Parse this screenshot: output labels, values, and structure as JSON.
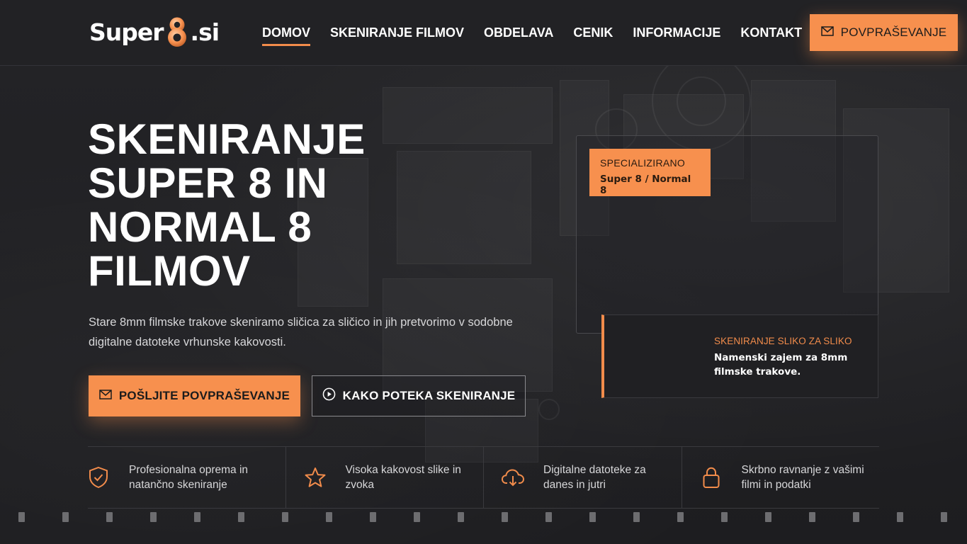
{
  "header": {
    "logo_left": "Super",
    "logo_right": ".si",
    "nav": [
      {
        "label": "DOMOV",
        "active": true
      },
      {
        "label": "SKENIRANJE FILMOV",
        "active": false
      },
      {
        "label": "OBDELAVA",
        "active": false
      },
      {
        "label": "CENIK",
        "active": false
      },
      {
        "label": "INFORMACIJE",
        "active": false
      },
      {
        "label": "KONTAKT",
        "active": false
      }
    ],
    "cta_label": "POVPRAŠEVANJE",
    "cta_icon": "envelope-icon"
  },
  "hero": {
    "title": "SKENIRANJE SUPER 8 IN NORMAL 8 FILMOV",
    "description": "Stare 8mm filmske trakove skeniramo sličica za sličico in jih pretvorimo v sodobne digitalne datoteke vrhunske kakovosti.",
    "primary_button": "POŠLJITE POVPRAŠEVANJE",
    "secondary_button": "KAKO POTEKA SKENIRANJE"
  },
  "panel": {
    "badge_top": "SPECIALIZIRANO",
    "badge_bottom": "Super 8 / Normal 8",
    "card_label": "SKENIRANJE SLIKO ZA SLIKO",
    "card_text": "Namenski zajem za 8mm filmske trakove."
  },
  "features": [
    {
      "icon": "shield-check-icon",
      "text": "Profesionalna oprema in natančno skeniranje"
    },
    {
      "icon": "star-icon",
      "text": "Visoka kakovost slike in zvoka"
    },
    {
      "icon": "cloud-download-icon",
      "text": "Digitalne datoteke za danes in jutri"
    },
    {
      "icon": "lock-icon",
      "text": "Skrbno ravnanje z vašimi filmi in podatki"
    }
  ],
  "colors": {
    "accent": "#f7904e",
    "background": "#1f1f21",
    "header": "#222225"
  }
}
